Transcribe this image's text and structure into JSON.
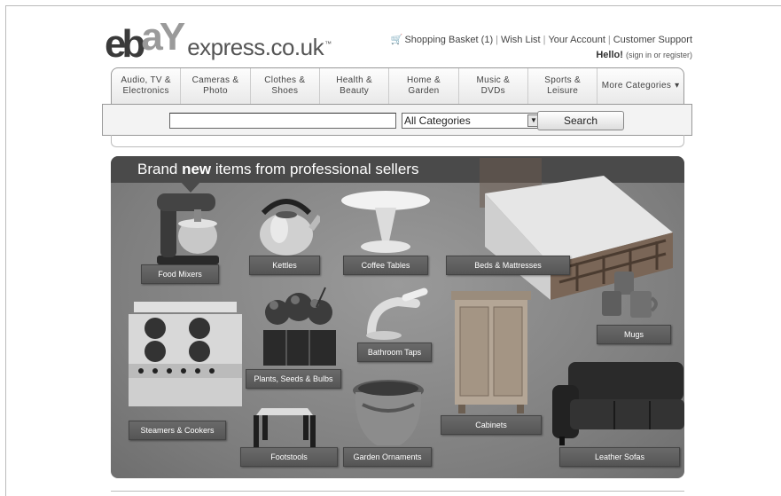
{
  "header": {
    "logo_eb": "eb",
    "logo_ay": "aY",
    "logo_express": "express.co.uk",
    "logo_tm": "™",
    "links": [
      "Shopping Basket (1)",
      "Wish List",
      "Your Account",
      "Customer Support"
    ],
    "hello": "Hello!",
    "signin": "(sign in or register)"
  },
  "categories": [
    {
      "line1": "Audio, TV &",
      "line2": "Electronics"
    },
    {
      "line1": "Cameras &",
      "line2": "Photo"
    },
    {
      "line1": "Clothes &",
      "line2": "Shoes"
    },
    {
      "line1": "Health &",
      "line2": "Beauty"
    },
    {
      "line1": "Home &",
      "line2": "Garden"
    },
    {
      "line1": "Music &",
      "line2": "DVDs"
    },
    {
      "line1": "Sports &",
      "line2": "Leisure"
    },
    {
      "line1": "More Categories",
      "line2": "▾"
    }
  ],
  "search": {
    "value": "",
    "category": "All Categories",
    "button": "Search"
  },
  "banner": {
    "title_pre": "Brand ",
    "title_bold": "new",
    "title_post": " items from professional sellers",
    "products": [
      "Food Mixers",
      "Kettles",
      "Coffee Tables",
      "Beds & Mattresses",
      "Mugs",
      "Plants, Seeds & Bulbs",
      "Bathroom Taps",
      "Cabinets",
      "Steamers & Cookers",
      "Footstools",
      "Garden Ornaments",
      "Leather Sofas"
    ]
  }
}
